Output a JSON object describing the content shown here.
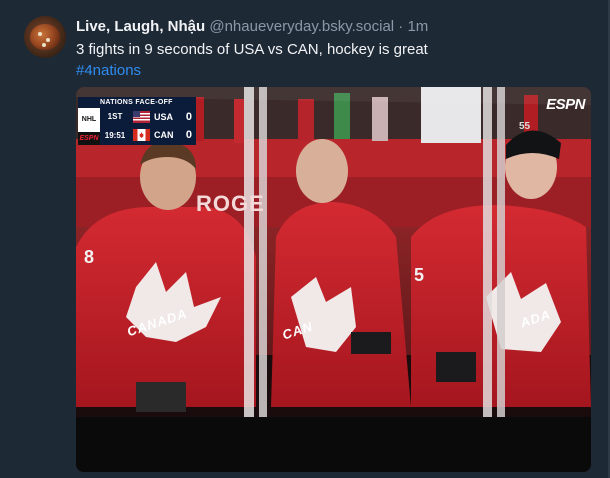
{
  "post": {
    "author_name": "Live, Laugh, Nhậu",
    "author_handle": "@nhaueveryday.bsky.social",
    "separator": "·",
    "timestamp": "1m",
    "text": "3 fights in 9 seconds of USA vs CAN, hockey is great",
    "hashtag": "#4nations"
  },
  "scoreboard": {
    "header": "NATIONS FACE-OFF",
    "league": "NHL",
    "network": "ESPN",
    "period": "1ST",
    "clock": "19:51",
    "teams": [
      {
        "code": "USA",
        "score": "0"
      },
      {
        "code": "CAN",
        "score": "0"
      }
    ]
  },
  "broadcast": {
    "logo": "ESPN"
  },
  "scene_text": {
    "board": "ROGE",
    "jersey_1": "CANADA",
    "jersey_2": "CAN",
    "jersey_3": "ADA",
    "number_left": "8",
    "number_right": "5",
    "helmet_number": "55"
  },
  "colors": {
    "accent_link": "#2f8cf0",
    "background": "#1e2936",
    "jersey_red": "#c8202b"
  }
}
